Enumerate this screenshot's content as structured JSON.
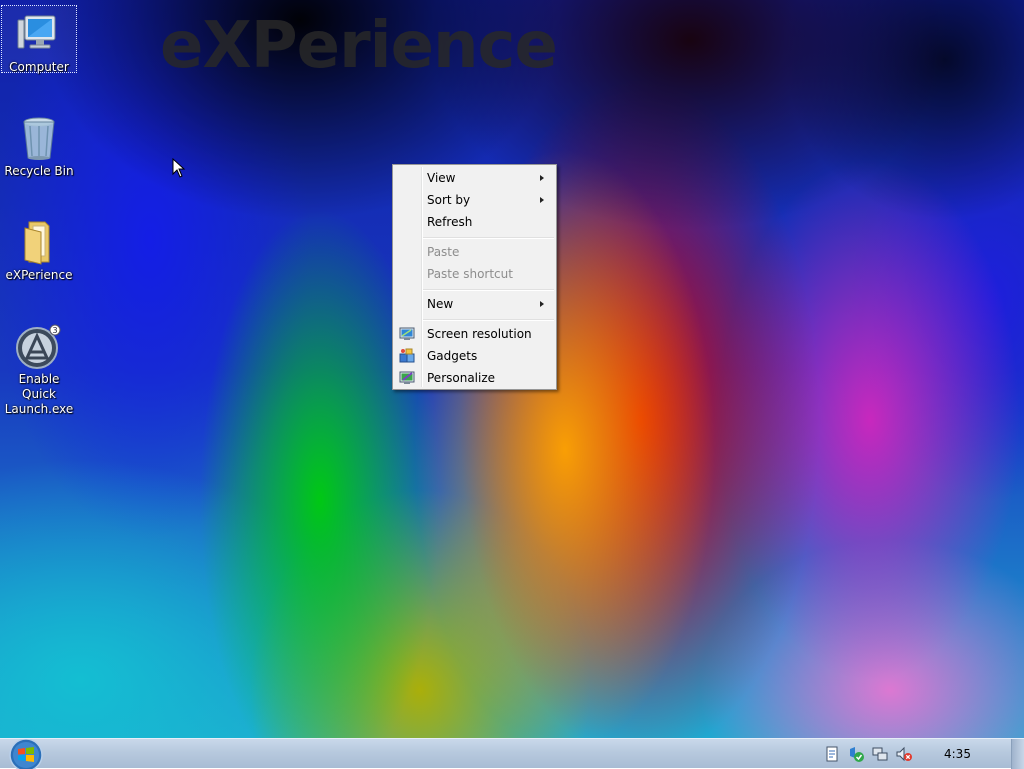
{
  "wallpaper": {
    "text": "eXPerience"
  },
  "desktop_icons": [
    {
      "label": "Computer",
      "icon": "computer-icon",
      "selected": true
    },
    {
      "label": "Recycle Bin",
      "icon": "recycle-bin-icon",
      "selected": false
    },
    {
      "label": "eXPerience",
      "icon": "folder-icon",
      "selected": false
    },
    {
      "label": "Enable Quick\nLaunch.exe",
      "icon": "app-launcher-icon",
      "selected": false
    }
  ],
  "context_menu": {
    "items": [
      {
        "label": "View",
        "submenu": true,
        "enabled": true
      },
      {
        "label": "Sort by",
        "submenu": true,
        "enabled": true
      },
      {
        "label": "Refresh",
        "submenu": false,
        "enabled": true
      },
      {
        "label": "Paste",
        "submenu": false,
        "enabled": false
      },
      {
        "label": "Paste shortcut",
        "submenu": false,
        "enabled": false
      },
      {
        "label": "New",
        "submenu": true,
        "enabled": true
      },
      {
        "label": "Screen resolution",
        "submenu": false,
        "enabled": true,
        "icon": "screen-resolution-icon"
      },
      {
        "label": "Gadgets",
        "submenu": false,
        "enabled": true,
        "icon": "gadgets-icon"
      },
      {
        "label": "Personalize",
        "submenu": false,
        "enabled": true,
        "icon": "personalize-icon"
      }
    ]
  },
  "taskbar": {
    "clock": "4:35",
    "tray_icons": [
      "notes-icon",
      "security-shield-icon",
      "network-icon",
      "volume-muted-icon"
    ]
  }
}
